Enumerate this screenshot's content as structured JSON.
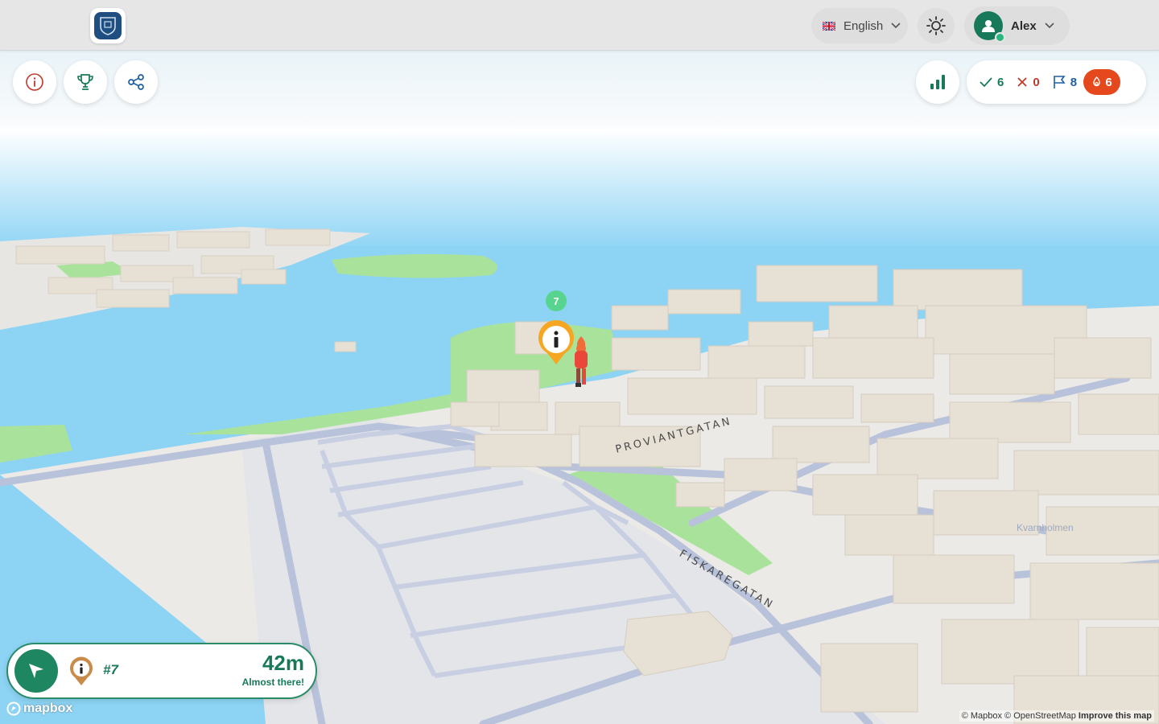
{
  "header": {
    "logo_name": "city-crest-logo",
    "language": {
      "flag": "gb-flag",
      "label": "English"
    },
    "theme_icon": "sun-icon",
    "user": {
      "name": "Alex",
      "status": "online"
    }
  },
  "toolbar": {
    "left_buttons": [
      "info-icon",
      "trophy-icon",
      "share-icon"
    ],
    "right_button": "leaderboard-icon"
  },
  "stats": {
    "correct": "6",
    "wrong": "0",
    "flags": "8",
    "streak": "6"
  },
  "map": {
    "streets": [
      "PROVIANTGATAN",
      "FISKAREGATAN"
    ],
    "district": "Kvarnholmen",
    "cluster_count": "7",
    "attribution": {
      "mapbox": "© Mapbox",
      "osm": "© OpenStreetMap",
      "improve": "Improve this map"
    },
    "logo_text": "mapbox"
  },
  "navigation": {
    "target": "#7",
    "distance": "42m",
    "status": "Almost there!"
  },
  "colors": {
    "brand_green": "#17795a",
    "streak_orange": "#e4481c",
    "water": "#8dd3f4",
    "park": "#a9e39b",
    "building": "#e7e0d5",
    "marker": "#f5a623"
  }
}
